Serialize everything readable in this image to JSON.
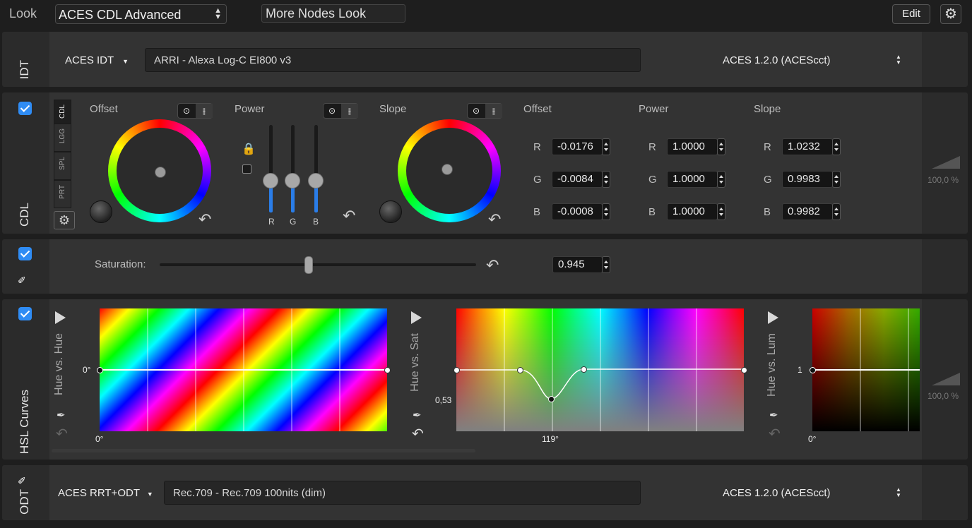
{
  "topbar": {
    "look_label": "Look",
    "look_select": "ACES CDL Advanced",
    "name_field": "More Nodes Look",
    "edit_button": "Edit"
  },
  "idt": {
    "section_label": "IDT",
    "type_label": "ACES IDT",
    "preset": "ARRI - Alexa Log-C EI800 v3",
    "color_space": "ACES 1.2.0 (ACEScct)"
  },
  "cdl": {
    "section_label": "CDL",
    "tabs": [
      "CDL",
      "LGG",
      "SPL",
      "PRT"
    ],
    "offset_label": "Offset",
    "power_label": "Power",
    "slope_label": "Slope",
    "channel_labels": [
      "R",
      "G",
      "B"
    ],
    "numbers": {
      "offset_header": "Offset",
      "power_header": "Power",
      "slope_header": "Slope",
      "offset": [
        "-0.0176",
        "-0.0084",
        "-0.0008"
      ],
      "power": [
        "1.0000",
        "1.0000",
        "1.0000"
      ],
      "slope": [
        "1.0232",
        "0.9983",
        "0.9982"
      ]
    },
    "opacity": "100,0 %"
  },
  "saturation": {
    "label": "Saturation:",
    "value": "0.945",
    "level": 0.945
  },
  "hsl": {
    "section_label": "HSL Curves",
    "curves": [
      {
        "name": "Hue vs. Hue",
        "y_label": "0°",
        "x_label": "0°"
      },
      {
        "name": "Hue vs. Sat",
        "y_label": "0,53",
        "x_label": "119°"
      },
      {
        "name": "Hue vs. Lum",
        "y_label": "1",
        "x_label": "0°"
      }
    ],
    "opacity": "100,0 %"
  },
  "odt": {
    "section_label": "ODT",
    "type_label": "ACES RRT+ODT",
    "preset": "Rec.709 - Rec.709 100nits (dim)",
    "color_space": "ACES 1.2.0 (ACEScct)"
  }
}
